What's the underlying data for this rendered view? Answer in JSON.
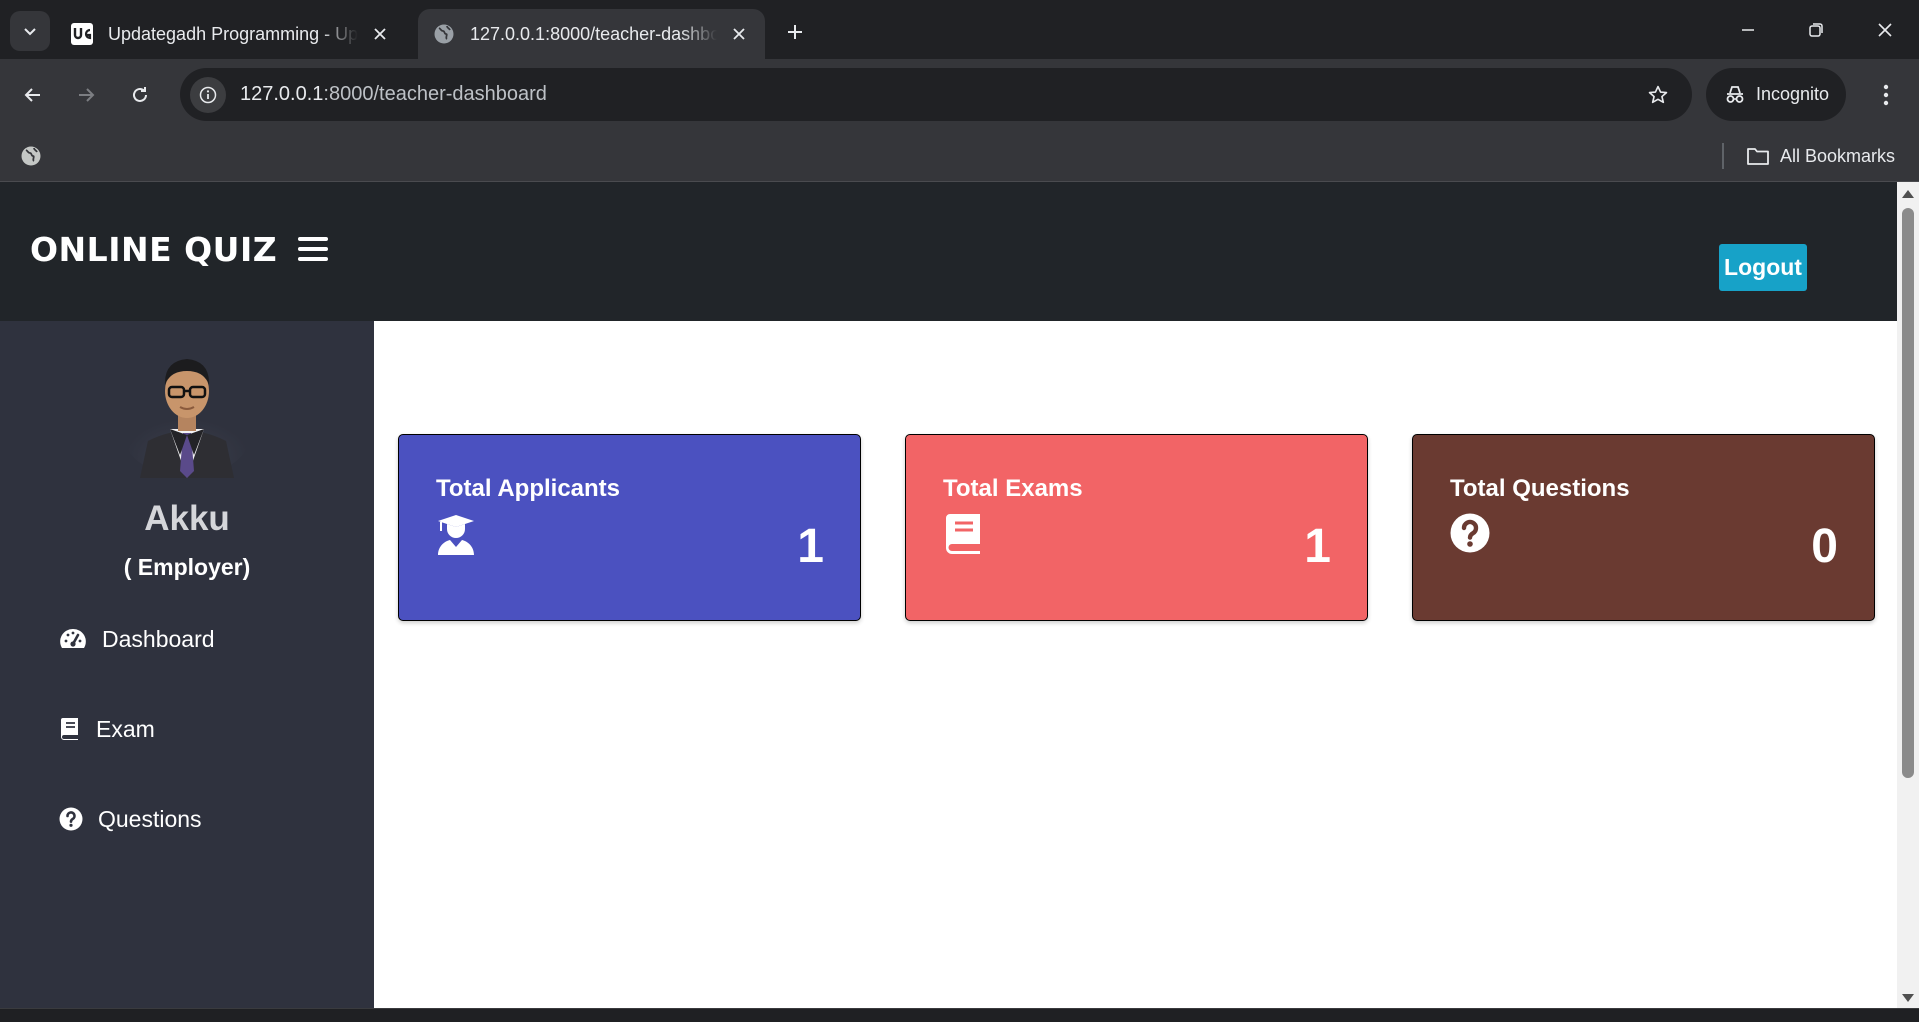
{
  "browser": {
    "tabs": [
      {
        "title": "Updategadh Programming - Up",
        "favicon": "updategadh-logo-icon",
        "active": false
      },
      {
        "title": "127.0.0.1:8000/teacher-dashboard",
        "favicon": "globe-icon",
        "active": true
      }
    ],
    "address": {
      "host": "127.0.0.1",
      "rest": ":8000/teacher-dashboard"
    },
    "profile_label": "Incognito",
    "bookmarks_label": "All Bookmarks"
  },
  "app": {
    "brand": "ONLINE QUIZ",
    "logout_label": "Logout",
    "user": {
      "name": "Akku",
      "role": "( Employer)"
    },
    "nav": [
      {
        "label": "Dashboard",
        "icon": "tachometer-icon"
      },
      {
        "label": "Exam",
        "icon": "book-icon"
      },
      {
        "label": "Questions",
        "icon": "question-circle-icon"
      }
    ],
    "cards": [
      {
        "title": "Total Applicants",
        "value": "1",
        "icon": "user-graduate-icon",
        "color": "#4b51c0"
      },
      {
        "title": "Total Exams",
        "value": "1",
        "icon": "book-icon",
        "color": "#f26466"
      },
      {
        "title": "Total Questions",
        "value": "0",
        "icon": "question-circle-icon",
        "color": "#6a3a31"
      }
    ]
  },
  "colors": {
    "chrome_dark": "#202124",
    "chrome_toolbar": "#35363a",
    "topnav": "#212529",
    "sidebar": "#2f323e",
    "logout": "#17a2c8"
  }
}
